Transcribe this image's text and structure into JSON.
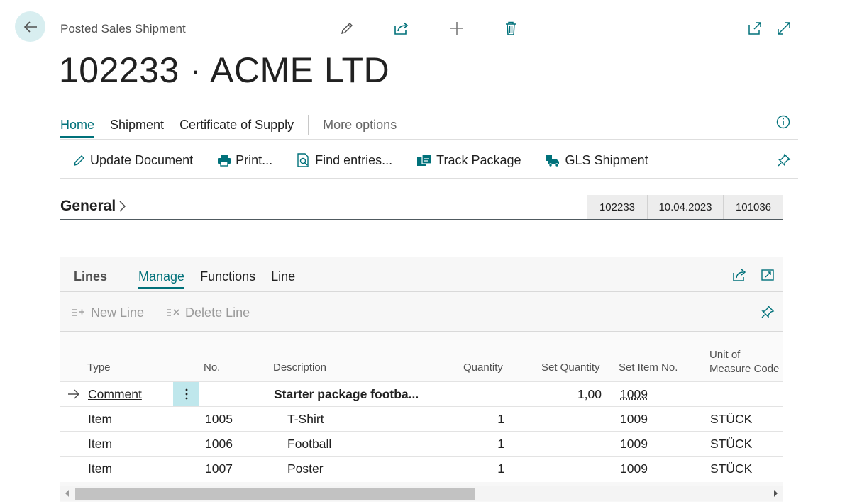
{
  "header": {
    "caption": "Posted Sales Shipment",
    "title": "102233 · ACME LTD",
    "icons": [
      "back-arrow-icon",
      "pencil-icon",
      "share-icon",
      "plus-icon",
      "trash-icon",
      "open-new-window-icon",
      "expand-icon"
    ]
  },
  "action_tabs": {
    "home": "Home",
    "shipment": "Shipment",
    "certificate": "Certificate of Supply",
    "more": "More options"
  },
  "actions": {
    "update_document": "Update Document",
    "print": "Print...",
    "find_entries": "Find entries...",
    "track_package": "Track Package",
    "gls_shipment": "GLS Shipment"
  },
  "general": {
    "title": "General",
    "summary": [
      "102233",
      "10.04.2023",
      "101036"
    ]
  },
  "lines": {
    "title": "Lines",
    "tabs": {
      "manage": "Manage",
      "functions": "Functions",
      "line": "Line"
    },
    "actions": {
      "new_line": "New Line",
      "delete_line": "Delete Line"
    },
    "columns": {
      "type": "Type",
      "no": "No.",
      "description": "Description",
      "quantity": "Quantity",
      "set_quantity": "Set Quantity",
      "set_item_no": "Set Item No.",
      "uom_1": "Unit of",
      "uom_2": "Measure Code"
    },
    "rows": [
      {
        "type": "Comment",
        "no": "",
        "description": "Starter package footba...",
        "quantity": "",
        "set_quantity": "1,00",
        "set_item_no": "1009",
        "uom": ""
      },
      {
        "type": "Item",
        "no": "1005",
        "description": "T-Shirt",
        "quantity": "1",
        "set_quantity": "",
        "set_item_no": "1009",
        "uom": "STÜCK"
      },
      {
        "type": "Item",
        "no": "1006",
        "description": "Football",
        "quantity": "1",
        "set_quantity": "",
        "set_item_no": "1009",
        "uom": "STÜCK"
      },
      {
        "type": "Item",
        "no": "1007",
        "description": "Poster",
        "quantity": "1",
        "set_quantity": "",
        "set_item_no": "1009",
        "uom": "STÜCK"
      }
    ]
  },
  "colors": {
    "accent": "#00717a",
    "selected_cell": "#bfe7ec"
  }
}
